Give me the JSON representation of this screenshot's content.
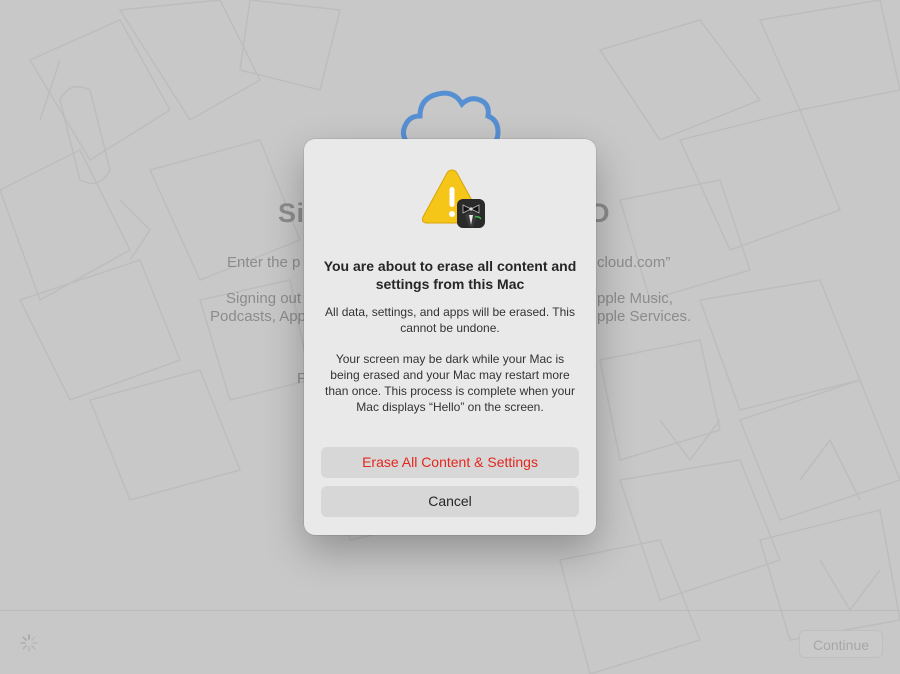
{
  "background": {
    "heading_left": "Si",
    "heading_right": "ID",
    "line1_left": "Enter the p",
    "line1_right": "cloud.com”",
    "line2_left": "Signing out",
    "line2_right": "pple Music,",
    "line3_left": "Podcasts, App",
    "line3_right": "pple Services.",
    "line4_left": "P"
  },
  "footer": {
    "continue_label": "Continue"
  },
  "dialog": {
    "title": "You are about to erase all content and settings from this Mac",
    "message1": "All data, settings, and apps will be erased. This cannot be undone.",
    "message2": "Your screen may be dark while your Mac is being erased and your Mac may restart more than once. This process is complete when your Mac displays “Hello” on the screen.",
    "erase_label": "Erase All Content & Settings",
    "cancel_label": "Cancel"
  },
  "colors": {
    "destructive": "#e3271f",
    "cloud": "#4a8fe0",
    "warning": "#f5c518"
  },
  "icons": [
    "cloud-icon",
    "warning-icon",
    "assistant-icon",
    "spinner-icon"
  ]
}
